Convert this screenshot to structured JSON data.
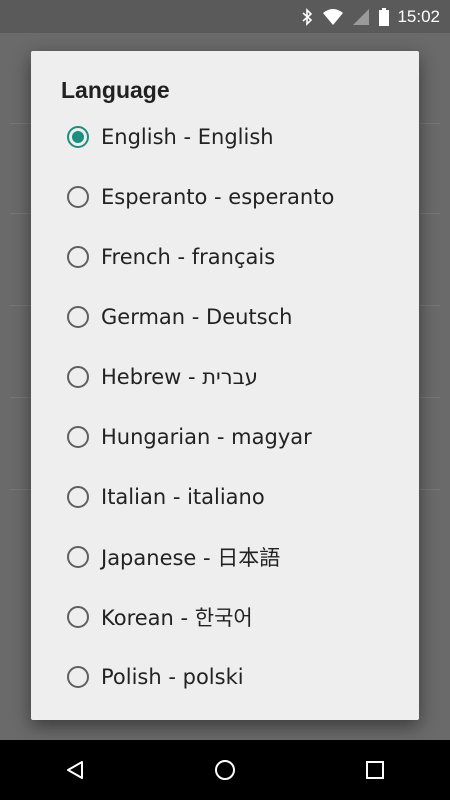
{
  "status_bar": {
    "time": "15:02",
    "icons": [
      "bluetooth-icon",
      "wifi-icon",
      "signal-icon",
      "battery-icon"
    ]
  },
  "dialog": {
    "title": "Language",
    "accent_color": "#1e8e7e",
    "options": [
      {
        "label": "English - English",
        "selected": true
      },
      {
        "label": "Esperanto - esperanto",
        "selected": false
      },
      {
        "label": "French - français",
        "selected": false
      },
      {
        "label": "German - Deutsch",
        "selected": false
      },
      {
        "label": "Hebrew - עברית",
        "selected": false
      },
      {
        "label": "Hungarian - magyar",
        "selected": false
      },
      {
        "label": "Italian - italiano",
        "selected": false
      },
      {
        "label": "Japanese - 日本語",
        "selected": false
      },
      {
        "label": "Korean - 한국어",
        "selected": false
      },
      {
        "label": "Polish - polski",
        "selected": false
      }
    ]
  },
  "nav_bar": {
    "buttons": [
      "back-icon",
      "home-icon",
      "recents-icon"
    ]
  }
}
